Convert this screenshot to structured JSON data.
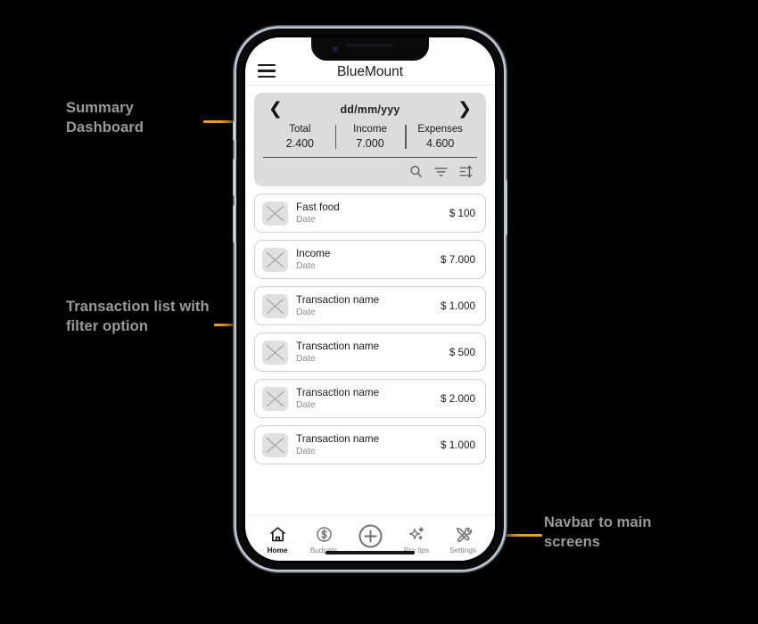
{
  "annotations": [
    {
      "id": "summary",
      "text": "Summary\nDashboard",
      "arrow": "right"
    },
    {
      "id": "list",
      "text": "Transaction list with\nfilter option",
      "arrow": "right"
    },
    {
      "id": "nav",
      "text": "Navbar to main\nscreens",
      "arrow": "left"
    }
  ],
  "accent_color": "#eda01c",
  "annotation_text_color": "#9a9a9a",
  "phone": {
    "header": {
      "menu_icon": "hamburger-icon",
      "title": "BlueMount"
    },
    "summary": {
      "prev_icon": "chevron-left-icon",
      "next_icon": "chevron-right-icon",
      "date_label": "dd/mm/yyy",
      "totals": [
        {
          "label": "Total",
          "value": "2.400"
        },
        {
          "label": "Income",
          "value": "7.000"
        },
        {
          "label": "Expenses",
          "value": "4.600"
        }
      ],
      "tools": [
        {
          "name": "search-icon"
        },
        {
          "name": "filter-icon"
        },
        {
          "name": "sort-icon"
        }
      ]
    },
    "transactions": [
      {
        "name": "Fast food",
        "date": "Date",
        "amount": "$ 100"
      },
      {
        "name": "Income",
        "date": "Date",
        "amount": "$ 7.000"
      },
      {
        "name": "Transaction name",
        "date": "Date",
        "amount": "$ 1.000"
      },
      {
        "name": "Transaction name",
        "date": "Date",
        "amount": "$ 500"
      },
      {
        "name": "Transaction name",
        "date": "Date",
        "amount": "$ 2.000"
      },
      {
        "name": "Transaction name",
        "date": "Date",
        "amount": "$ 1.000"
      }
    ],
    "bottom_nav": {
      "items": [
        {
          "label": "Home",
          "icon": "home-icon",
          "active": true
        },
        {
          "label": "Budgets",
          "icon": "budget-dollar-icon",
          "active": false
        },
        {
          "label": "Pro tips",
          "icon": "sparkle-icon",
          "active": false
        },
        {
          "label": "Settings",
          "icon": "tools-icon",
          "active": false
        }
      ],
      "add_button_icon": "plus-circle-icon"
    }
  }
}
